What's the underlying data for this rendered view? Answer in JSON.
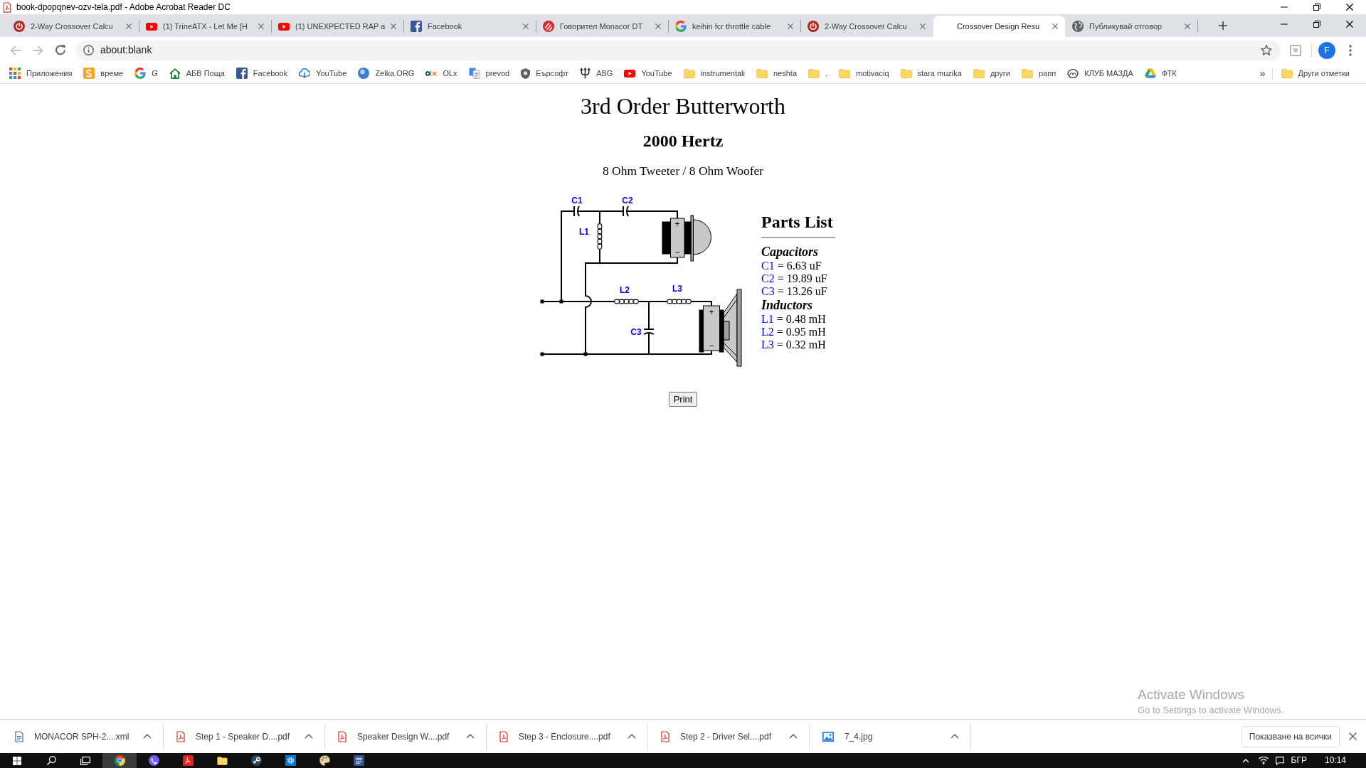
{
  "title_bar": {
    "title": "book-dpopqnev-ozv-tela.pdf - Adobe Acrobat Reader DC"
  },
  "browser": {
    "tabs": [
      {
        "title": "2-Way Crossover Calcu",
        "selected": false
      },
      {
        "title": "(1) TrineATX - Let Me [H",
        "selected": false
      },
      {
        "title": "(1) UNEXPECTED RAP a",
        "selected": false
      },
      {
        "title": "Facebook",
        "selected": false
      },
      {
        "title": "Говорител Monacor DT",
        "selected": false
      },
      {
        "title": "keihin fcr throttle cable",
        "selected": false
      },
      {
        "title": "2-Way Crossover Calcu",
        "selected": false
      },
      {
        "title": "Crossover Design Resu",
        "selected": true
      },
      {
        "title": "Публикувай отговор",
        "selected": false
      }
    ],
    "navigation": {
      "back_disabled": true,
      "forward_disabled": true
    },
    "address": "about:blank",
    "profile_initial": "F",
    "bookmarks": [
      "Приложения",
      "време",
      "G",
      "АБВ Поща",
      "Facebook",
      "YouTube",
      "Zelka.ORG",
      "OLx",
      "prevod",
      "Еърсофт",
      "ABG",
      "YouTube",
      "instrumentali",
      "neshta",
      ".",
      "motivaciq",
      "stara muzika",
      "други",
      "рапп",
      "КЛУБ МАЗДА",
      "ФТК"
    ],
    "bookmarks_overflow": "»",
    "other_bookmarks": "Други отметки"
  },
  "page": {
    "title": "3rd Order Butterworth",
    "frequency": "2000 Hertz",
    "drivers": "8 Ohm Tweeter / 8 Ohm Woofer",
    "circuit": {
      "components": [
        {
          "kind": "capacitor",
          "label": "C1"
        },
        {
          "kind": "capacitor",
          "label": "C2"
        },
        {
          "kind": "inductor",
          "label": "L1"
        },
        {
          "kind": "inductor",
          "label": "L2"
        },
        {
          "kind": "inductor",
          "label": "L3"
        },
        {
          "kind": "capacitor",
          "label": "C3"
        }
      ],
      "speakers": [
        {
          "kind": "tweeter",
          "plus": "+",
          "minus": "−"
        },
        {
          "kind": "woofer",
          "plus": "+",
          "minus": "−"
        }
      ]
    },
    "parts_list": {
      "title": "Parts List",
      "groups": [
        {
          "heading": "Capacitors",
          "items": [
            {
              "name": "C1",
              "value": "= 6.63 uF"
            },
            {
              "name": "C2",
              "value": "= 19.89 uF"
            },
            {
              "name": "C3",
              "value": "= 13.26 uF"
            }
          ]
        },
        {
          "heading": "Inductors",
          "items": [
            {
              "name": "L1",
              "value": "= 0.48 mH"
            },
            {
              "name": "L2",
              "value": "= 0.95 mH"
            },
            {
              "name": "L3",
              "value": "= 0.32 mH"
            }
          ]
        }
      ]
    },
    "print_button": "Print"
  },
  "downloads": {
    "items": [
      {
        "filename": "MONACOR SPH-2....xml",
        "kind": "document"
      },
      {
        "filename": "Step 1 - Speaker D....pdf",
        "kind": "pdf"
      },
      {
        "filename": "Speaker Design W....pdf",
        "kind": "pdf"
      },
      {
        "filename": "Step 3 - Enclosure....pdf",
        "kind": "pdf"
      },
      {
        "filename": "Step 2 - Driver Sel....pdf",
        "kind": "pdf"
      },
      {
        "filename": "7_4.jpg",
        "kind": "image"
      }
    ],
    "show_all": "Показване на всички"
  },
  "taskbar": {
    "apps": [
      {
        "selected": true
      },
      {
        "selected": false
      },
      {
        "selected": false
      },
      {
        "selected": false
      },
      {
        "selected": false
      },
      {
        "selected": false
      },
      {
        "selected": false
      },
      {
        "selected": false
      }
    ],
    "language": "БГР",
    "clock": "10:14"
  },
  "activation_notice": {
    "title": "Activate Windows",
    "hint": "Go to Settings to activate Windows."
  }
}
